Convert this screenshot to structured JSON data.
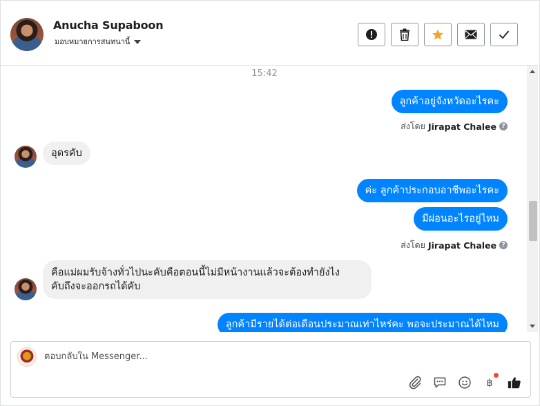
{
  "header": {
    "name": "Anucha Supaboon",
    "assign_label": "มอบหมายการสนทนานี้"
  },
  "colors": {
    "outgoing": "#0084ff",
    "incoming": "#f1f0f0",
    "star": "#f5a623"
  },
  "messages": {
    "timestamp": "15:42",
    "out1": "ลูกค้าอยู่จังหวัดอะไรคะ",
    "sent_by_prefix": "ส่งโดย",
    "sender1": "Jirapat Chalee",
    "in1": "อุดรคับ",
    "out2": "ค่ะ ลูกค้าประกอบอาชีพอะไรคะ",
    "out3": "มีผ่อนอะไรอยู่ไหม",
    "sender2": "Jirapat Chalee",
    "in2_line1": "คือแม่ผมรับจ้างทั่วไปนะคับคือตอนนี้ไม่มีหน้างานแล้วจะต้องทำยังไง",
    "in2_line2": "คับถึงจะออกรถได้คับ",
    "out4": "ลูกค้ามีรายได้ต่อเดือนประมาณเท่าไหร่คะ พอจะประมาณได้ไหม"
  },
  "composer": {
    "placeholder": "ตอบกลับใน Messenger..."
  },
  "icons": [
    "alert-icon",
    "trash-icon",
    "star-icon",
    "envelope-icon",
    "check-icon",
    "attach-icon",
    "comment-icon",
    "emoji-icon",
    "baht-icon",
    "like-icon"
  ]
}
